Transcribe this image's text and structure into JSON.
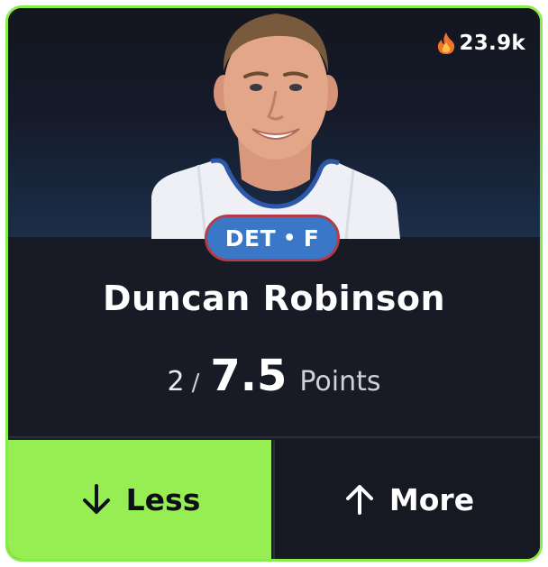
{
  "trending": {
    "icon": "fire-icon",
    "value": "23.9k"
  },
  "player": {
    "name": "Duncan Robinson",
    "team": "DET",
    "separator": "•",
    "position": "F",
    "photo": "player-headshot"
  },
  "projection": {
    "current": "2",
    "separator": "/",
    "line": "7.5",
    "stat": "Points"
  },
  "actions": {
    "less_label": "Less",
    "less_icon": "arrow-down-icon",
    "more_label": "More",
    "more_icon": "arrow-up-icon"
  },
  "colors": {
    "accent": "#86ec4b",
    "less_bg": "#96ee52",
    "card_bg": "#181a26",
    "badge_bg": "#3a78c7",
    "badge_border": "#b23d4a"
  }
}
